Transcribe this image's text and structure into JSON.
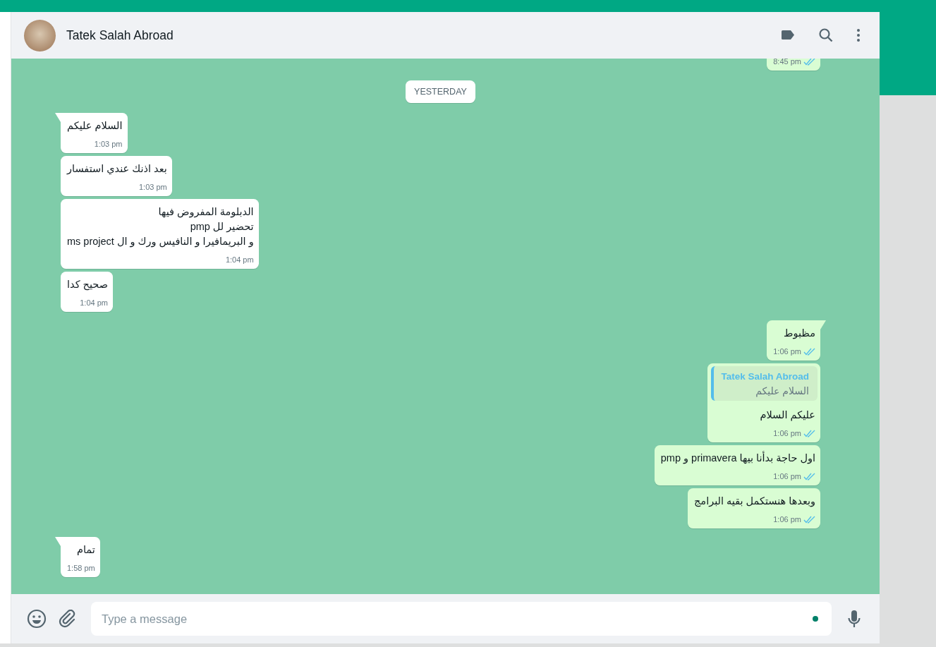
{
  "chat_header": {
    "contact_name": "Tatek Salah Abroad"
  },
  "messages": [
    {
      "kind": "message",
      "outgoing": true,
      "time": "8:45 pm",
      "read": true,
      "tail": false
    },
    {
      "kind": "date",
      "label": "YESTERDAY"
    },
    {
      "kind": "message",
      "outgoing": false,
      "text": "السلام عليكم",
      "time": "1:03 pm",
      "tail": true
    },
    {
      "kind": "message",
      "outgoing": false,
      "text": "بعد اذنك عندي استفسار",
      "time": "1:03 pm",
      "tail": false
    },
    {
      "kind": "message",
      "outgoing": false,
      "text": "الدبلومة المفروض فيها\nتحضير لل pmp\nو البريمافيرا و النافيس ورك و ال ms project",
      "time": "1:04 pm",
      "tail": false
    },
    {
      "kind": "message",
      "outgoing": false,
      "text": "صحيح كدا",
      "time": "1:04 pm",
      "tail": false
    },
    {
      "kind": "message",
      "outgoing": true,
      "text": "مظبوط",
      "time": "1:06 pm",
      "read": true,
      "tail": true
    },
    {
      "kind": "message",
      "outgoing": true,
      "quote": {
        "author": "Tatek Salah Abroad",
        "text": "السلام عليكم"
      },
      "text": "عليكم السلام",
      "time": "1:06 pm",
      "read": true,
      "tail": false
    },
    {
      "kind": "message",
      "outgoing": true,
      "text": "اول حاجة بدأنا بيها primavera و pmp",
      "time": "1:06 pm",
      "read": true,
      "tail": false
    },
    {
      "kind": "message",
      "outgoing": true,
      "text": "وبعدها هنستكمل بقيه البرامج",
      "time": "1:06 pm",
      "read": true,
      "tail": false
    },
    {
      "kind": "message",
      "outgoing": false,
      "text": "تمام",
      "time": "1:58 pm",
      "tail": true
    }
  ],
  "composer": {
    "placeholder": "Type a message"
  }
}
